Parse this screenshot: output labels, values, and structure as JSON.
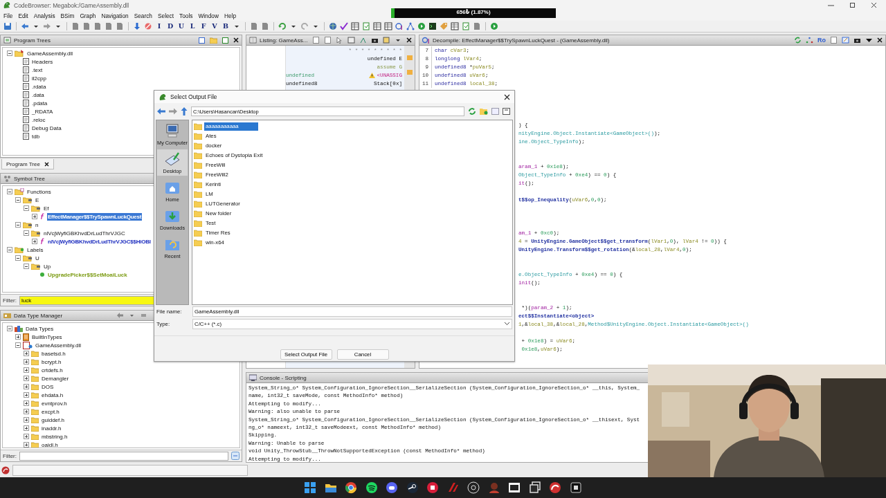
{
  "window": {
    "title": "CodeBrowser: Megabok:/GameAssembly.dll"
  },
  "menu": [
    "File",
    "Edit",
    "Analysis",
    "BSim",
    "Graph",
    "Navigation",
    "Search",
    "Select",
    "Tools",
    "Window",
    "Help"
  ],
  "toolbar": {
    "letters": [
      "I",
      "D",
      "U",
      "L",
      "F",
      "V",
      "B"
    ]
  },
  "overlay_bar": {
    "text": "656₺ (1.87%)",
    "level": 0.02
  },
  "program_trees": {
    "title": "Program Trees",
    "tab": "Program Tree",
    "nodes": [
      {
        "label": "GameAssembly.dll",
        "kind": "program",
        "expanded": true,
        "children": [
          {
            "label": "Headers",
            "kind": "doc"
          },
          {
            "label": ".text",
            "kind": "doc"
          },
          {
            "label": "il2cpp",
            "kind": "doc"
          },
          {
            "label": ".rdata",
            "kind": "doc"
          },
          {
            "label": ".data",
            "kind": "doc"
          },
          {
            "label": ".pdata",
            "kind": "doc"
          },
          {
            "label": "_RDATA",
            "kind": "doc"
          },
          {
            "label": ".reloc",
            "kind": "doc"
          },
          {
            "label": "Debug Data",
            "kind": "doc"
          },
          {
            "label": "tdb",
            "kind": "doc"
          }
        ]
      }
    ]
  },
  "symbol_tree": {
    "title": "Symbol Tree",
    "nodes": [
      {
        "label": "Functions",
        "kind": "functions",
        "expanded": true,
        "selected": false,
        "children": [
          {
            "label": "E",
            "kind": "namespace",
            "expanded": true,
            "selected": false,
            "children": [
              {
                "label": "Ef",
                "kind": "namespace",
                "expanded": true,
                "selected": false,
                "children": [
                  {
                    "label": "EffectManager$$TrySpawnLuckQuest",
                    "kind": "function",
                    "expanded": false,
                    "selected": true
                  }
                ]
              }
            ]
          },
          {
            "label": "n",
            "kind": "namespace",
            "expanded": true,
            "selected": false,
            "children": [
              {
                "label": "nlVcjWyfiGBKhvdDrLudThrVJGC",
                "kind": "namespace",
                "expanded": true,
                "selected": false,
                "children": [
                  {
                    "label": "nlVcjWyfiGBKhvdDrLudThrVJGC$$HiOBI",
                    "kind": "function",
                    "expanded": false,
                    "selected": false
                  }
                ]
              }
            ]
          }
        ]
      },
      {
        "label": "Labels",
        "kind": "labels",
        "expanded": true,
        "selected": false,
        "children": [
          {
            "label": "U",
            "kind": "namespace",
            "expanded": true,
            "selected": false,
            "children": [
              {
                "label": "Up",
                "kind": "namespace",
                "expanded": true,
                "selected": false,
                "children": [
                  {
                    "label": "UpgradePicker$$SetMoaiLuck",
                    "kind": "label",
                    "selected": false
                  }
                ]
              }
            ]
          }
        ]
      }
    ],
    "filter": {
      "label": "Filter:",
      "value": "luck"
    }
  },
  "data_type_manager": {
    "title": "Data Type Manager",
    "nodes": [
      {
        "label": "Data Types",
        "kind": "datatypes",
        "expanded": true,
        "children": [
          {
            "label": "BuiltInTypes",
            "kind": "builtin",
            "expanded": false
          },
          {
            "label": "GameAssembly.dll",
            "kind": "archive",
            "expanded": true,
            "children": [
              {
                "label": "basetsd.h",
                "kind": "folder",
                "expanded": false
              },
              {
                "label": "bcrypt.h",
                "kind": "folder",
                "expanded": false
              },
              {
                "label": "crtdefs.h",
                "kind": "folder",
                "expanded": false
              },
              {
                "label": "Demangler",
                "kind": "folder",
                "expanded": false
              },
              {
                "label": "DOS",
                "kind": "folder",
                "expanded": false
              },
              {
                "label": "ehdata.h",
                "kind": "folder",
                "expanded": false
              },
              {
                "label": "evntprov.h",
                "kind": "folder",
                "expanded": false
              },
              {
                "label": "excpt.h",
                "kind": "folder",
                "expanded": false
              },
              {
                "label": "guiddef.h",
                "kind": "folder",
                "expanded": false
              },
              {
                "label": "inaddr.h",
                "kind": "folder",
                "expanded": false
              },
              {
                "label": "mbstring.h",
                "kind": "folder",
                "expanded": false
              },
              {
                "label": "oaidl.h",
                "kind": "folder",
                "expanded": false
              }
            ]
          }
        ]
      }
    ],
    "filter": {
      "label": "Filter:"
    }
  },
  "listing": {
    "title": "Listing:  GameAss...",
    "rows": [
      {
        "right": {
          "text": "* * * * * * * * *",
          "kind": "comment"
        }
      },
      {
        "right": {
          "text": "undefined E",
          "kind": "plain"
        }
      },
      {
        "right": {
          "text": "assume G",
          "kind": "assume"
        }
      },
      {
        "left": {
          "text": "undefined",
          "kind": "type"
        },
        "warning": true,
        "right": {
          "text": "<UNASSIG",
          "kind": "register"
        }
      },
      {
        "left": {
          "text": "undefined8",
          "kind": "plain"
        },
        "right": {
          "text": "Stack[0x]",
          "kind": "plain"
        }
      }
    ]
  },
  "decompile": {
    "title": "Decompile: EffectManager$$TrySpawnLuckQuest -  (GameAssembly.dll)",
    "read_only": "Ro",
    "lines": [
      {
        "number": "7",
        "code": [
          {
            "kind": "type",
            "text": "char"
          },
          {
            "kind": "var",
            "text": " cVar3"
          },
          {
            "kind": "plain",
            "text": ";"
          }
        ]
      },
      {
        "number": "8",
        "code": [
          {
            "kind": "type",
            "text": "longlong"
          },
          {
            "kind": "var",
            "text": " lVar4"
          },
          {
            "kind": "plain",
            "text": ";"
          }
        ]
      },
      {
        "number": "9",
        "code": [
          {
            "kind": "type",
            "text": "undefined8"
          },
          {
            "kind": "plain",
            "text": " *"
          },
          {
            "kind": "var",
            "text": "puVar5"
          },
          {
            "kind": "plain",
            "text": ";"
          }
        ]
      },
      {
        "number": "10",
        "code": [
          {
            "kind": "type",
            "text": "undefined8"
          },
          {
            "kind": "var",
            "text": " uVar6"
          },
          {
            "kind": "plain",
            "text": ";"
          }
        ]
      },
      {
        "number": "11",
        "code": [
          {
            "kind": "type",
            "text": "undefined8"
          },
          {
            "kind": "var",
            "text": " local_38"
          },
          {
            "kind": "plain",
            "text": ";"
          }
        ]
      }
    ],
    "fragments": [
      {
        "kind": "blank"
      },
      {
        "kind": "blank"
      },
      {
        "kind": "blank"
      },
      {
        "kind": "blank"
      },
      {
        "kind": "code",
        "code": [
          {
            "kind": "plain",
            "text": ") {"
          }
        ]
      },
      {
        "kind": "code",
        "code": [
          {
            "kind": "const",
            "text": "nityEngine.Object.Instantiate<GameObject>()"
          },
          {
            "kind": "plain",
            "text": ");"
          }
        ]
      },
      {
        "kind": "code",
        "code": [
          {
            "kind": "const",
            "text": "ine.Object_TypeInfo"
          },
          {
            "kind": "plain",
            "text": ");"
          }
        ]
      },
      {
        "kind": "blank"
      },
      {
        "kind": "blank"
      },
      {
        "kind": "code",
        "code": [
          {
            "kind": "param",
            "text": "aram_1"
          },
          {
            "kind": "plain",
            "text": " + "
          },
          {
            "kind": "num",
            "text": "0x1e8"
          },
          {
            "kind": "plain",
            "text": ");"
          }
        ]
      },
      {
        "kind": "code",
        "code": [
          {
            "kind": "const",
            "text": "Object_TypeInfo"
          },
          {
            "kind": "plain",
            "text": " + "
          },
          {
            "kind": "num",
            "text": "0xe4"
          },
          {
            "kind": "plain",
            "text": ") == "
          },
          {
            "kind": "num",
            "text": "0"
          },
          {
            "kind": "plain",
            "text": ") {"
          }
        ]
      },
      {
        "kind": "code",
        "code": [
          {
            "kind": "param",
            "text": "it"
          },
          {
            "kind": "plain",
            "text": "();"
          }
        ]
      },
      {
        "kind": "blank"
      },
      {
        "kind": "code",
        "code": [
          {
            "kind": "func",
            "text": "t$$op_Inequality"
          },
          {
            "kind": "plain",
            "text": "("
          },
          {
            "kind": "var",
            "text": "uVar6"
          },
          {
            "kind": "plain",
            "text": ","
          },
          {
            "kind": "num",
            "text": "0"
          },
          {
            "kind": "plain",
            "text": ","
          },
          {
            "kind": "num",
            "text": "0"
          },
          {
            "kind": "plain",
            "text": ");"
          }
        ]
      },
      {
        "kind": "blank"
      },
      {
        "kind": "blank"
      },
      {
        "kind": "blank"
      },
      {
        "kind": "code",
        "code": [
          {
            "kind": "param",
            "text": "am_1"
          },
          {
            "kind": "plain",
            "text": " + "
          },
          {
            "kind": "num",
            "text": "0xc0"
          },
          {
            "kind": "plain",
            "text": ");"
          }
        ]
      },
      {
        "kind": "code",
        "code": [
          {
            "kind": "var",
            "text": "4"
          },
          {
            "kind": "plain",
            "text": " = "
          },
          {
            "kind": "func",
            "text": "UnityEngine.GameObject$$get_transform"
          },
          {
            "kind": "plain",
            "text": "("
          },
          {
            "kind": "var",
            "text": "lVar1"
          },
          {
            "kind": "plain",
            "text": ","
          },
          {
            "kind": "num",
            "text": "0"
          },
          {
            "kind": "plain",
            "text": "), "
          },
          {
            "kind": "var",
            "text": "lVar4"
          },
          {
            "kind": "plain",
            "text": " != "
          },
          {
            "kind": "num",
            "text": "0"
          },
          {
            "kind": "plain",
            "text": ")) {"
          }
        ]
      },
      {
        "kind": "code",
        "code": [
          {
            "kind": "func",
            "text": "UnityEngine.Transform$$get_rotation"
          },
          {
            "kind": "plain",
            "text": "(&"
          },
          {
            "kind": "var",
            "text": "local_28"
          },
          {
            "kind": "plain",
            "text": ","
          },
          {
            "kind": "var",
            "text": "lVar4"
          },
          {
            "kind": "plain",
            "text": ","
          },
          {
            "kind": "num",
            "text": "0"
          },
          {
            "kind": "plain",
            "text": ");"
          }
        ]
      },
      {
        "kind": "blank"
      },
      {
        "kind": "blank"
      },
      {
        "kind": "code",
        "code": [
          {
            "kind": "const",
            "text": "e.Object_TypeInfo"
          },
          {
            "kind": "plain",
            "text": " + "
          },
          {
            "kind": "num",
            "text": "0xe4"
          },
          {
            "kind": "plain",
            "text": ") == "
          },
          {
            "kind": "num",
            "text": "0"
          },
          {
            "kind": "plain",
            "text": ") {"
          }
        ]
      },
      {
        "kind": "code",
        "code": [
          {
            "kind": "param",
            "text": "init"
          },
          {
            "kind": "plain",
            "text": "();"
          }
        ]
      },
      {
        "kind": "blank"
      },
      {
        "kind": "blank"
      },
      {
        "kind": "code",
        "code": [
          {
            "kind": "plain",
            "text": " *)("
          },
          {
            "kind": "param",
            "text": "param_2"
          },
          {
            "kind": "plain",
            "text": " + "
          },
          {
            "kind": "num",
            "text": "1"
          },
          {
            "kind": "plain",
            "text": ");"
          }
        ]
      },
      {
        "kind": "code",
        "code": [
          {
            "kind": "func",
            "text": "ect$$Instantiate<object>"
          }
        ]
      },
      {
        "kind": "code",
        "code": [
          {
            "kind": "var",
            "text": "1"
          },
          {
            "kind": "plain",
            "text": ",&"
          },
          {
            "kind": "var",
            "text": "local_38"
          },
          {
            "kind": "plain",
            "text": ",&"
          },
          {
            "kind": "var",
            "text": "local_28"
          },
          {
            "kind": "plain",
            "text": ","
          },
          {
            "kind": "const",
            "text": "Method$UnityEngine.Object.Instantiate<GameObject>()"
          }
        ]
      },
      {
        "kind": "blank"
      },
      {
        "kind": "code",
        "code": [
          {
            "kind": "plain",
            "text": " + "
          },
          {
            "kind": "num",
            "text": "0x1e8"
          },
          {
            "kind": "plain",
            "text": ") = "
          },
          {
            "kind": "var",
            "text": "uVar6"
          },
          {
            "kind": "plain",
            "text": ";"
          }
        ]
      },
      {
        "kind": "code",
        "code": [
          {
            "kind": "num",
            "text": " 0x1e8"
          },
          {
            "kind": "plain",
            "text": ","
          },
          {
            "kind": "var",
            "text": "uVar6"
          },
          {
            "kind": "plain",
            "text": ");"
          }
        ]
      }
    ]
  },
  "console": {
    "title": "Console - Scripting",
    "lines": [
      "System_String_o* System_Configuration_IgnoreSection__SerializeSection (System_Configuration_IgnoreSection_o* __this, System_",
      "name, int32_t saveMode, const MethodInfo* method)",
      "Attempting to modify...",
      "Warning: also unable to parse",
      "System_String_o* System_Configuration_IgnoreSection__SerializeSection (System_Configuration_IgnoreSection_o* __thisext, Syst",
      "ng_o* nameext, int32_t saveModeext, const MethodInfo* method)",
      "Skipping.",
      "Warning: Unable to parse",
      "void Unity_ThrowStub__ThrowNotSupportedException (const MethodInfo* method)",
      "Attempting to modify..."
    ]
  },
  "dialog": {
    "title": "Select Output File",
    "path": "C:\\Users\\Hasancan\\Desktop",
    "places": [
      {
        "label": "My Computer",
        "kind": "computer",
        "selected": false
      },
      {
        "label": "Desktop",
        "kind": "desktop",
        "selected": true
      },
      {
        "label": "Home",
        "kind": "home",
        "selected": false
      },
      {
        "label": "Downloads",
        "kind": "downloads",
        "selected": false
      },
      {
        "label": "Recent",
        "kind": "recent",
        "selected": false
      }
    ],
    "files": [
      {
        "name": "aaaaaaaaaaa",
        "selected": true
      },
      {
        "name": "Ates",
        "selected": false
      },
      {
        "name": "docker",
        "selected": false
      },
      {
        "name": "Echoes of Dystopia Exit",
        "selected": false
      },
      {
        "name": "FreeWill",
        "selected": false
      },
      {
        "name": "FreeWill2",
        "selected": false
      },
      {
        "name": "Kerinti",
        "selected": false
      },
      {
        "name": "LM",
        "selected": false
      },
      {
        "name": "LUTGenerator",
        "selected": false
      },
      {
        "name": "New folder",
        "selected": false
      },
      {
        "name": "Test",
        "selected": false
      },
      {
        "name": "Timer Res",
        "selected": false
      },
      {
        "name": "win-x64",
        "selected": false
      }
    ],
    "file_name": {
      "label": "File name:",
      "value": "GameAssembly.dll"
    },
    "type": {
      "label": "Type:",
      "value": "C/C++ (*.c)"
    },
    "buttons": [
      "Select Output File",
      "Cancel"
    ]
  }
}
